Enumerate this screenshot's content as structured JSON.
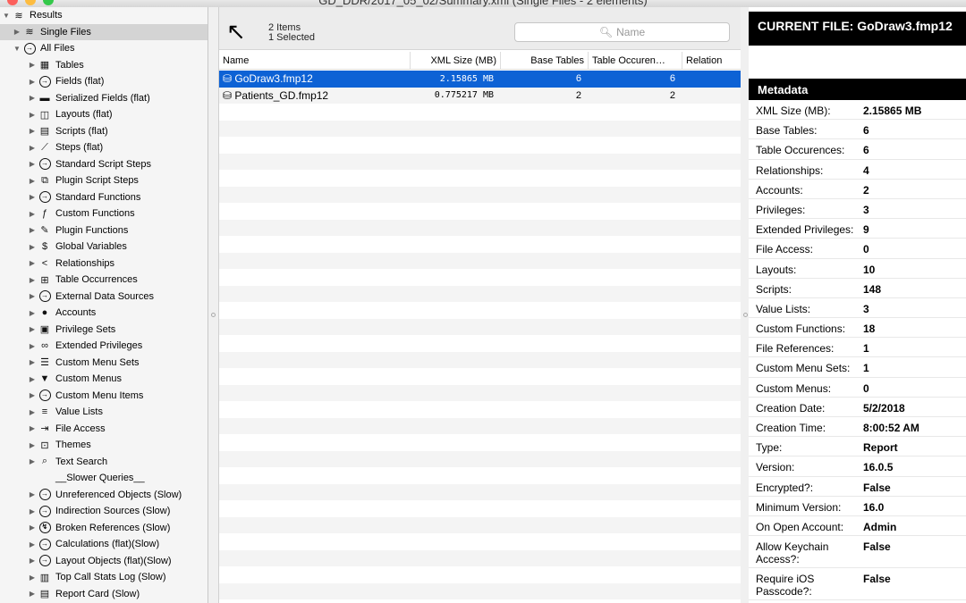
{
  "window": {
    "title": "GD_DDR/2017_05_02/Summary.xml (Single Files - 2 elements)",
    "lights": [
      "#fc605c",
      "#fdbc40",
      "#34c84a"
    ]
  },
  "sidebar": {
    "root": "Results",
    "single_files": "Single Files",
    "all_files": "All Files",
    "items": [
      {
        "label": "Tables",
        "icon": "table-icon"
      },
      {
        "label": "Fields (flat)",
        "icon": "circle-arrow-icon"
      },
      {
        "label": "Serialized Fields (flat)",
        "icon": "serialized-fields-icon"
      },
      {
        "label": "Layouts (flat)",
        "icon": "layout-icon"
      },
      {
        "label": "Scripts (flat)",
        "icon": "script-icon"
      },
      {
        "label": "Steps (flat)",
        "icon": "steps-icon"
      },
      {
        "label": "Standard Script Steps",
        "icon": "circle-arrow-icon"
      },
      {
        "label": "Plugin Script Steps",
        "icon": "plugin-script-icon"
      },
      {
        "label": "Standard Functions",
        "icon": "circle-arrow-icon"
      },
      {
        "label": "Custom Functions",
        "icon": "function-icon"
      },
      {
        "label": "Plugin Functions",
        "icon": "plugin-icon"
      },
      {
        "label": "Global Variables",
        "icon": "dollar-icon"
      },
      {
        "label": "Relationships",
        "icon": "share-icon"
      },
      {
        "label": "Table Occurrences",
        "icon": "table-occurrence-icon"
      },
      {
        "label": "External Data Sources",
        "icon": "circle-arrow-icon"
      },
      {
        "label": "Accounts",
        "icon": "person-icon"
      },
      {
        "label": "Privilege Sets",
        "icon": "lock-icon"
      },
      {
        "label": "Extended Privileges",
        "icon": "extended-privileges-icon"
      },
      {
        "label": "Custom Menu Sets",
        "icon": "menu-set-icon"
      },
      {
        "label": "Custom Menus",
        "icon": "triangle-down-icon"
      },
      {
        "label": "Custom Menu Items",
        "icon": "circle-arrow-icon"
      },
      {
        "label": "Value Lists",
        "icon": "list-icon"
      },
      {
        "label": "File Access",
        "icon": "file-access-icon"
      },
      {
        "label": "Themes",
        "icon": "theme-icon"
      },
      {
        "label": "Text Search",
        "icon": "search-icon"
      },
      {
        "label": "__Slower Queries__",
        "icon": ""
      },
      {
        "label": "Unreferenced Objects (Slow)",
        "icon": "circle-arrow-icon"
      },
      {
        "label": "Indirection Sources (Slow)",
        "icon": "circle-arrow-icon"
      },
      {
        "label": "Broken References (Slow)",
        "icon": "broken-reference-icon"
      },
      {
        "label": "Calculations (flat)(Slow)",
        "icon": "circle-arrow-icon"
      },
      {
        "label": "Layout Objects (flat)(Slow)",
        "icon": "circle-arrow-icon"
      },
      {
        "label": "Top Call Stats Log (Slow)",
        "icon": "log-icon"
      },
      {
        "label": "Report Card (Slow)",
        "icon": "report-card-icon"
      }
    ]
  },
  "list": {
    "count_items": "2 Items",
    "count_selected": "1 Selected",
    "search_placeholder": "Name",
    "columns": [
      "Name",
      "XML Size (MB)",
      "Base Tables",
      "Table Occuren…",
      "Relation"
    ],
    "files": [
      {
        "name": "GoDraw3.fmp12",
        "size": "2.15865 MB",
        "base": "6",
        "occ": "6",
        "selected": true
      },
      {
        "name": "Patients_GD.fmp12",
        "size": "0.775217 MB",
        "base": "2",
        "occ": "2",
        "selected": false
      }
    ]
  },
  "detail": {
    "current_file": "CURRENT FILE: GoDraw3.fmp12",
    "metadata_title": "Metadata",
    "rows": [
      {
        "k": "XML Size (MB):",
        "v": "2.15865 MB"
      },
      {
        "k": "Base Tables:",
        "v": "6"
      },
      {
        "k": "Table Occurences:",
        "v": "6"
      },
      {
        "k": "Relationships:",
        "v": "4"
      },
      {
        "k": "Accounts:",
        "v": "2"
      },
      {
        "k": "Privileges:",
        "v": "3"
      },
      {
        "k": "Extended Privileges:",
        "v": "9"
      },
      {
        "k": "File Access:",
        "v": "0"
      },
      {
        "k": "Layouts:",
        "v": "10"
      },
      {
        "k": "Scripts:",
        "v": "148"
      },
      {
        "k": "Value Lists:",
        "v": "3"
      },
      {
        "k": "Custom Functions:",
        "v": "18"
      },
      {
        "k": "File References:",
        "v": "1"
      },
      {
        "k": "Custom Menu Sets:",
        "v": "1"
      },
      {
        "k": "Custom Menus:",
        "v": "0"
      },
      {
        "k": "Creation Date:",
        "v": "5/2/2018"
      },
      {
        "k": "Creation Time:",
        "v": "8:00:52 AM"
      },
      {
        "k": "Type:",
        "v": "Report"
      },
      {
        "k": "Version:",
        "v": "16.0.5"
      },
      {
        "k": "Encrypted?:",
        "v": "False"
      },
      {
        "k": "Minimum Version:",
        "v": "16.0"
      },
      {
        "k": "On Open Account:",
        "v": "Admin"
      },
      {
        "k": "Allow Keychain Access?:",
        "v": "False"
      },
      {
        "k": "Require iOS Passcode?:",
        "v": "False"
      }
    ]
  }
}
